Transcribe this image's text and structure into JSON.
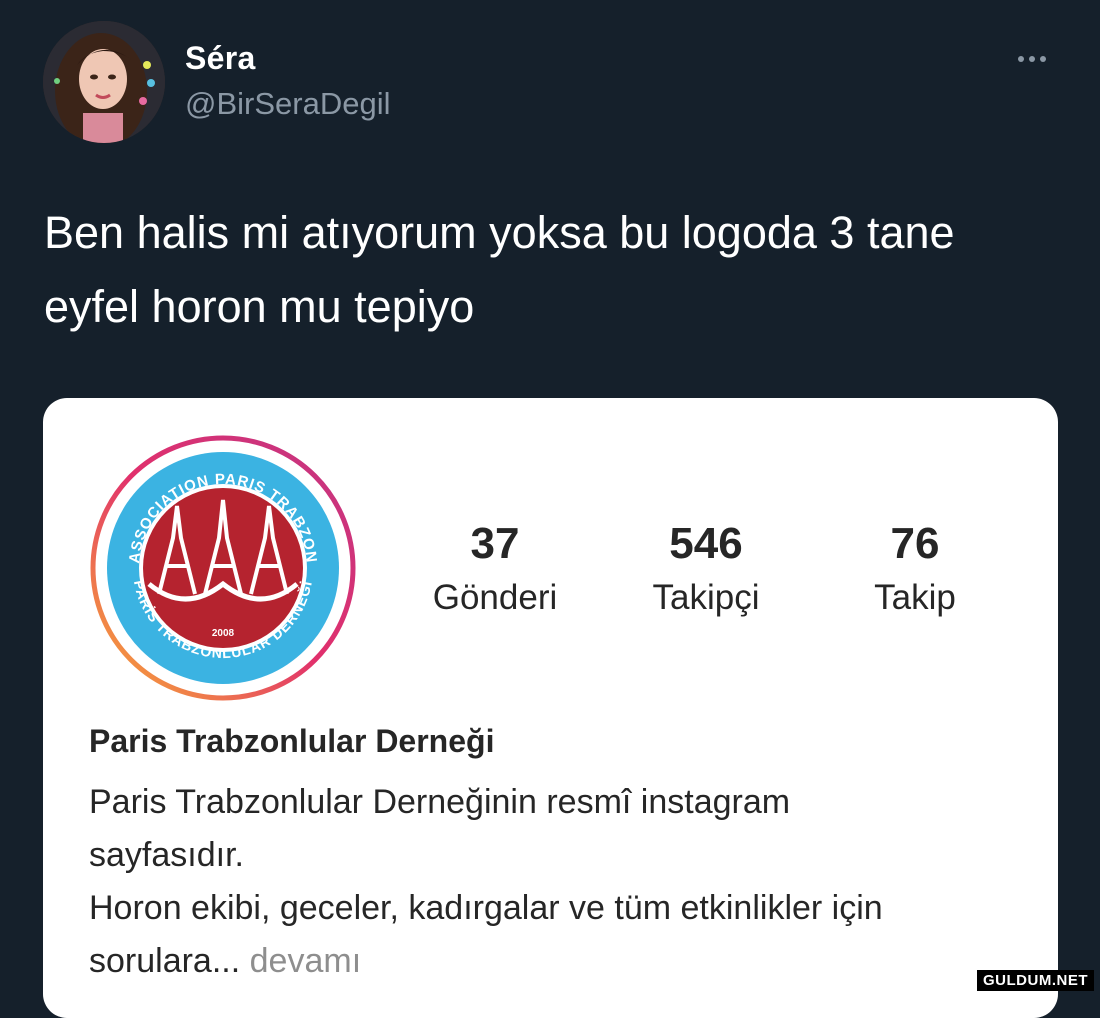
{
  "tweet": {
    "display_name": "Séra",
    "handle": "@BirSeraDegil",
    "text": "Ben halis mi atıyorum yoksa bu logoda 3 tane eyfel horon mu tepiyo"
  },
  "profile": {
    "logo_top_text": "ASSOCIATION PARIS TRABZON",
    "logo_bottom_text": "PARİS TRABZONLULAR DERNEĞİ",
    "logo_year": "2008",
    "stats": {
      "posts": {
        "count": "37",
        "label": "Gönderi"
      },
      "followers": {
        "count": "546",
        "label": "Takipçi"
      },
      "following": {
        "count": "76",
        "label": "Takip"
      }
    },
    "name": "Paris Trabzonlular Derneği",
    "bio_lines": [
      "Paris Trabzonlular Derneğinin resmî instagram",
      "sayfasıdır.",
      "Horon ekibi, geceler, kadırgalar ve tüm etkinlikler için",
      "sorulara..."
    ],
    "more_label": "devamı"
  },
  "watermark": "GULDUM.NET",
  "colors": {
    "background": "#15202b",
    "logo_red": "#b5232f",
    "logo_blue": "#3bb3e2",
    "ring_gradient": [
      "#f9b233",
      "#e1306c",
      "#c13584"
    ]
  }
}
